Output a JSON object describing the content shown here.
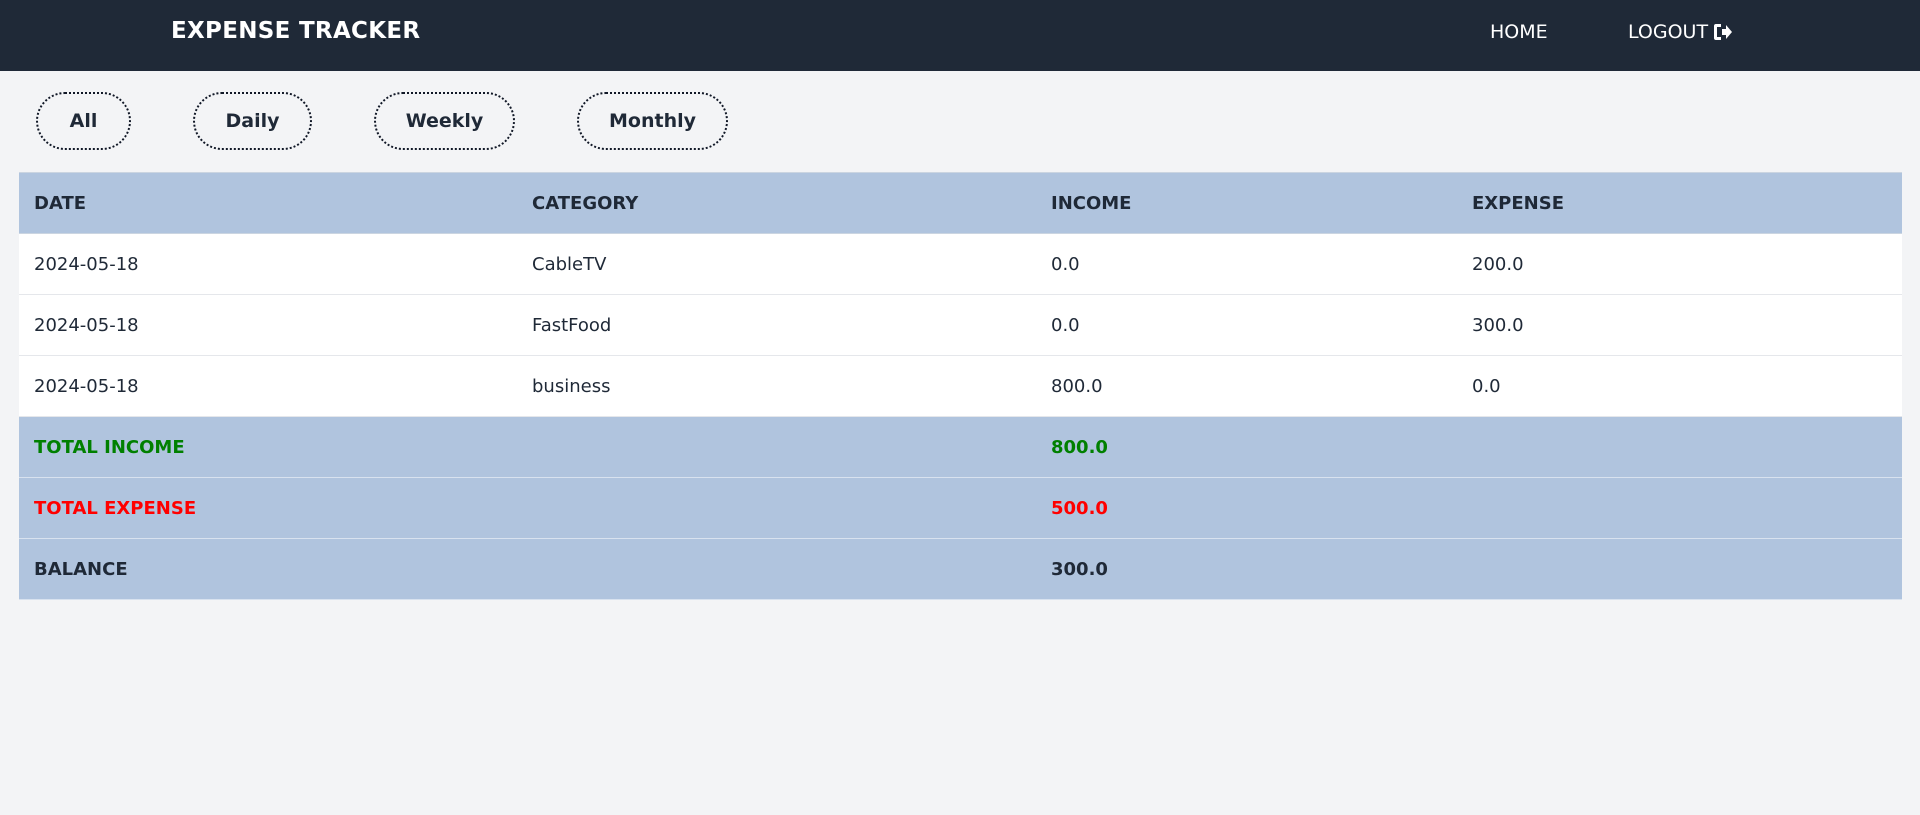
{
  "navbar": {
    "brand": "EXPENSE TRACKER",
    "home_label": "HOME",
    "logout_label": "LOGOUT",
    "logout_icon": "sign-out-icon"
  },
  "filters": {
    "all": "All",
    "daily": "Daily",
    "weekly": "Weekly",
    "monthly": "Monthly"
  },
  "table": {
    "headers": [
      "DATE",
      "CATEGORY",
      "INCOME",
      "EXPENSE"
    ],
    "rows": [
      {
        "date": "2024-05-18",
        "category": "CableTV",
        "income": "0.0",
        "expense": "200.0"
      },
      {
        "date": "2024-05-18",
        "category": "FastFood",
        "income": "0.0",
        "expense": "300.0"
      },
      {
        "date": "2024-05-18",
        "category": "business",
        "income": "800.0",
        "expense": "0.0"
      }
    ],
    "summary": {
      "total_income_label": "TOTAL INCOME",
      "total_income_value": "800.0",
      "total_expense_label": "TOTAL EXPENSE",
      "total_expense_value": "500.0",
      "balance_label": "BALANCE",
      "balance_value": "300.0"
    }
  },
  "colors": {
    "navbar_bg": "#1f2937",
    "table_header_bg": "#b0c4de",
    "income_color": "#008000",
    "expense_color": "#ff0000"
  }
}
